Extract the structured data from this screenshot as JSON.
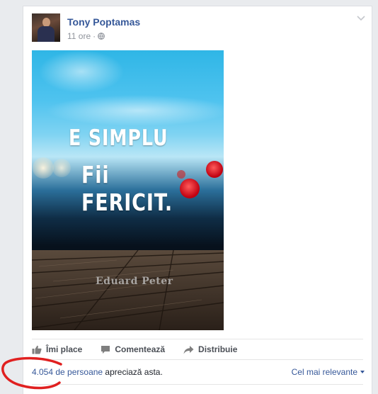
{
  "post": {
    "author": "Tony Poptamas",
    "time": "11 ore",
    "separator": "·",
    "audience_icon": "globe-icon",
    "image": {
      "line1": "E SIMPLU",
      "line2": "Fii FERICIT.",
      "signature": "Eduard Peter"
    }
  },
  "actions": {
    "like": "Îmi place",
    "comment": "Comentează",
    "share": "Distribuie"
  },
  "reactions": {
    "count_link": "4.054 de persoane",
    "suffix": " apreciază asta.",
    "sort_label": "Cel mai relevante"
  },
  "colors": {
    "link": "#365899",
    "annotation": "#e02020"
  }
}
